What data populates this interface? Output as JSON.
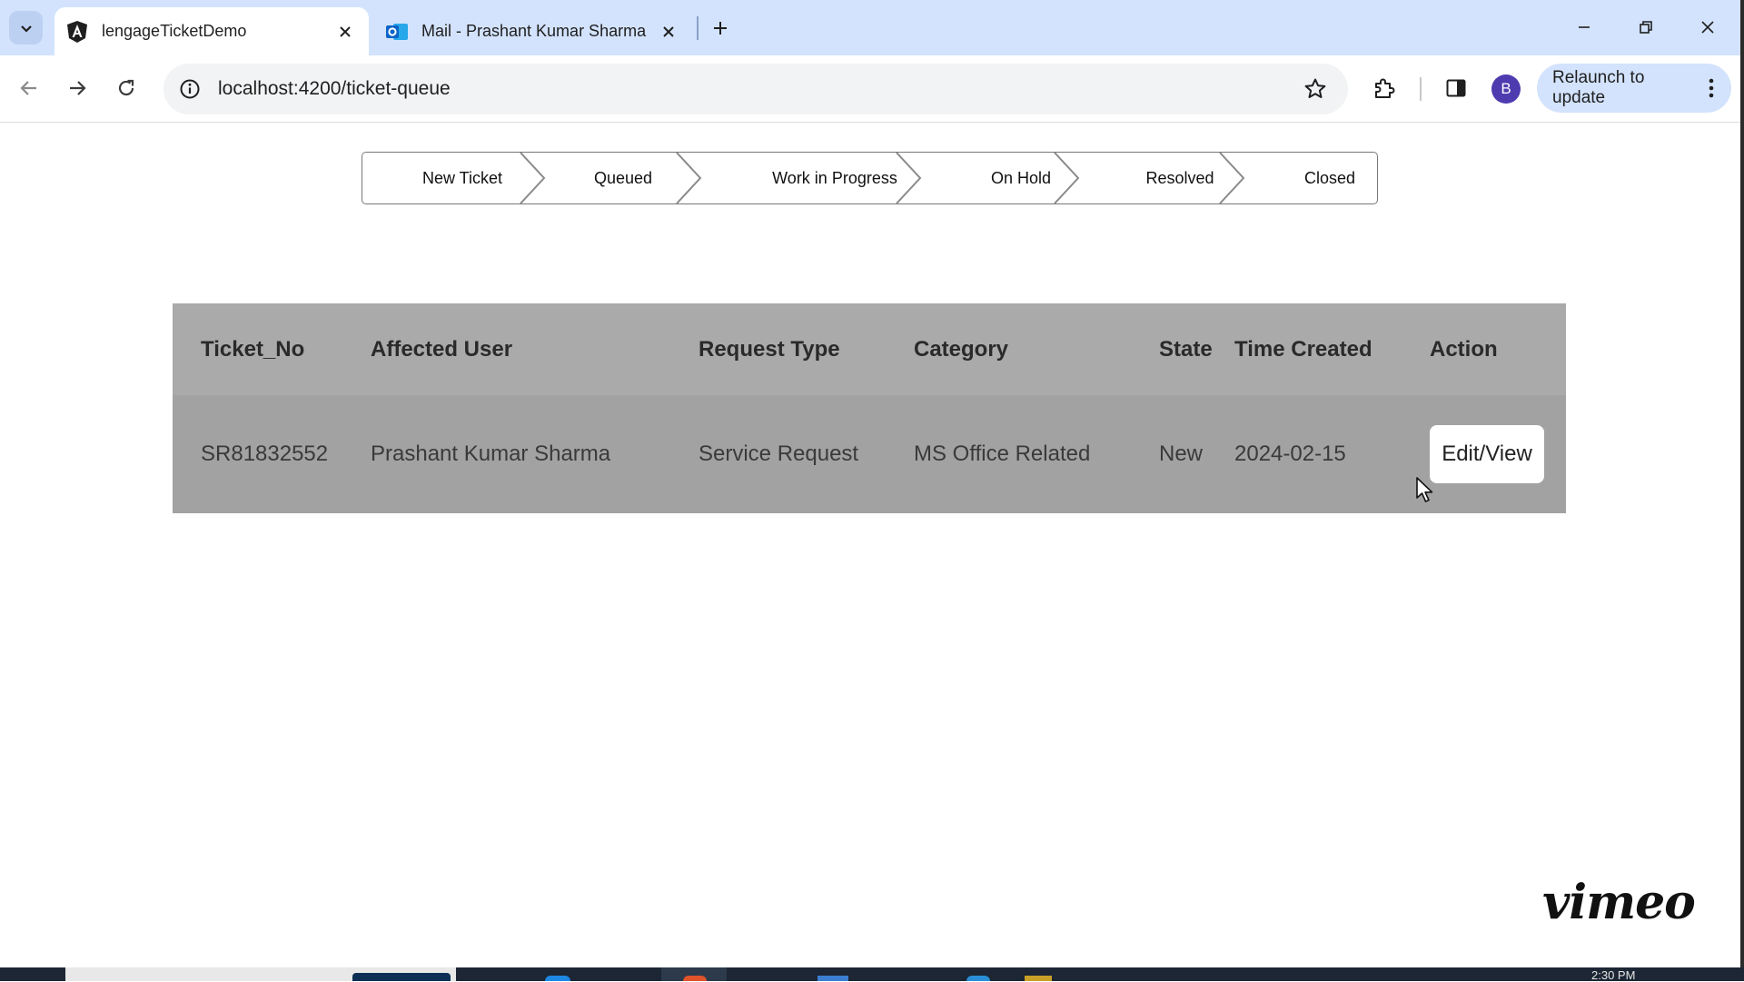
{
  "browser": {
    "tabs": [
      {
        "title": "lengageTicketDemo",
        "favicon": "angular-icon",
        "active": true
      },
      {
        "title": "Mail - Prashant Kumar Sharma",
        "favicon": "outlook-icon",
        "active": false
      }
    ],
    "url": "localhost:4200/ticket-queue",
    "profile_initial": "B",
    "relaunch_label": "Relaunch to update"
  },
  "stepper": {
    "steps": [
      "New Ticket",
      "Queued",
      "Work in Progress",
      "On Hold",
      "Resolved",
      "Closed"
    ]
  },
  "table": {
    "columns": [
      "Ticket_No",
      "Affected User",
      "Request Type",
      "Category",
      "State",
      "Time Created",
      "Action"
    ],
    "rows": [
      {
        "ticket_no": "SR81832552",
        "affected_user": "Prashant Kumar Sharma",
        "request_type": "Service Request",
        "category": "MS Office Related",
        "state": "New",
        "time_created": "2024-02-15",
        "action_label": "Edit/View"
      }
    ]
  },
  "watermark": "vimeo",
  "taskbar": {
    "clock": "2:30 PM"
  },
  "colors": {
    "tabstrip": "#d3e3fd",
    "table_header": "#aaaaaa",
    "table_row": "#a2a2a2",
    "avatar": "#4f3bb0"
  }
}
